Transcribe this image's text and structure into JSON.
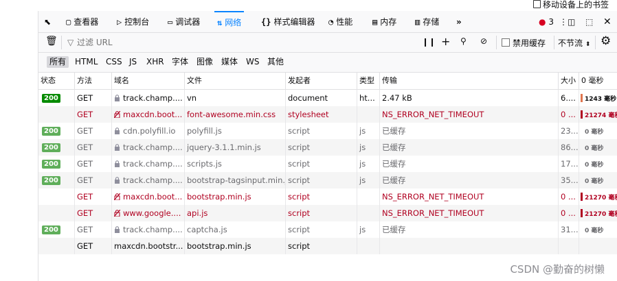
{
  "top": {
    "mobile_bookmarks": "移动设备上的书签"
  },
  "tabs": {
    "inspector": "查看器",
    "console": "控制台",
    "debugger": "调试器",
    "network": "网络",
    "style_editor": "样式编辑器",
    "performance": "性能",
    "memory": "内存",
    "storage": "存储",
    "error_count": "3"
  },
  "toolbar": {
    "filter_placeholder": "过滤 URL",
    "disable_cache": "禁用缓存",
    "throttle": "不节流"
  },
  "filters": [
    "所有",
    "HTML",
    "CSS",
    "JS",
    "XHR",
    "字体",
    "图像",
    "媒体",
    "WS",
    "其他"
  ],
  "columns": {
    "status": "状态",
    "method": "方法",
    "domain": "域名",
    "file": "文件",
    "initiator": "发起者",
    "type": "类型",
    "transferred": "传输",
    "size": "大小",
    "timeline": "0 毫秒"
  },
  "rows": [
    {
      "status": "200",
      "cached": false,
      "method": "GET",
      "domain": "track.champ....",
      "file": "vn",
      "initiator": "document",
      "type": "ht...",
      "transferred": "2.47 kB",
      "size": "6....",
      "time": "1243 毫秒",
      "state": "ok"
    },
    {
      "status": "",
      "cached": false,
      "method": "GET",
      "domain": "maxcdn.boot...",
      "file": "font-awesome.min.css",
      "initiator": "stylesheet",
      "type": "",
      "transferred": "NS_ERROR_NET_TIMEOUT",
      "size": "0 ...",
      "time": "21274 毫秒",
      "state": "error"
    },
    {
      "status": "200",
      "cached": true,
      "method": "GET",
      "domain": "cdn.polyfill.io",
      "file": "polyfill.js",
      "initiator": "script",
      "type": "js",
      "transferred": "已缓存",
      "size": "23....",
      "time": "0 毫秒",
      "state": "cached"
    },
    {
      "status": "200",
      "cached": true,
      "method": "GET",
      "domain": "track.champ....",
      "file": "jquery-3.1.1.min.js",
      "initiator": "script",
      "type": "js",
      "transferred": "已缓存",
      "size": "86....",
      "time": "0 毫秒",
      "state": "cached"
    },
    {
      "status": "200",
      "cached": true,
      "method": "GET",
      "domain": "track.champ....",
      "file": "scripts.js",
      "initiator": "script",
      "type": "js",
      "transferred": "已缓存",
      "size": "17....",
      "time": "0 毫秒",
      "state": "cached"
    },
    {
      "status": "200",
      "cached": true,
      "method": "GET",
      "domain": "track.champ....",
      "file": "bootstrap-tagsinput.min.js",
      "initiator": "script",
      "type": "js",
      "transferred": "已缓存",
      "size": "35....",
      "time": "0 毫秒",
      "state": "cached"
    },
    {
      "status": "",
      "cached": false,
      "method": "GET",
      "domain": "maxcdn.boot...",
      "file": "bootstrap.min.js",
      "initiator": "script",
      "type": "",
      "transferred": "NS_ERROR_NET_TIMEOUT",
      "size": "0 ...",
      "time": "21270 毫秒",
      "state": "error"
    },
    {
      "status": "",
      "cached": false,
      "method": "GET",
      "domain": "www.google....",
      "file": "api.js",
      "initiator": "script",
      "type": "",
      "transferred": "NS_ERROR_NET_TIMEOUT",
      "size": "0 ...",
      "time": "21270 毫秒",
      "state": "error"
    },
    {
      "status": "200",
      "cached": true,
      "method": "GET",
      "domain": "track.champ....",
      "file": "captcha.js",
      "initiator": "script",
      "type": "js",
      "transferred": "已缓存",
      "size": "31....",
      "time": "0 毫秒",
      "state": "cached"
    },
    {
      "status": "",
      "cached": false,
      "method": "GET",
      "domain": "maxcdn.bootstr...",
      "file": "bootstrap.min.js",
      "initiator": "script",
      "type": "",
      "transferred": "",
      "size": "",
      "time": "",
      "state": "pending"
    }
  ],
  "watermark": "CSDN @勤奋的树懒",
  "colors": {
    "accent": "#0a84ff",
    "error": "#b00020",
    "ok_badge": "#058b00",
    "cached_badge": "#5fae5a"
  }
}
